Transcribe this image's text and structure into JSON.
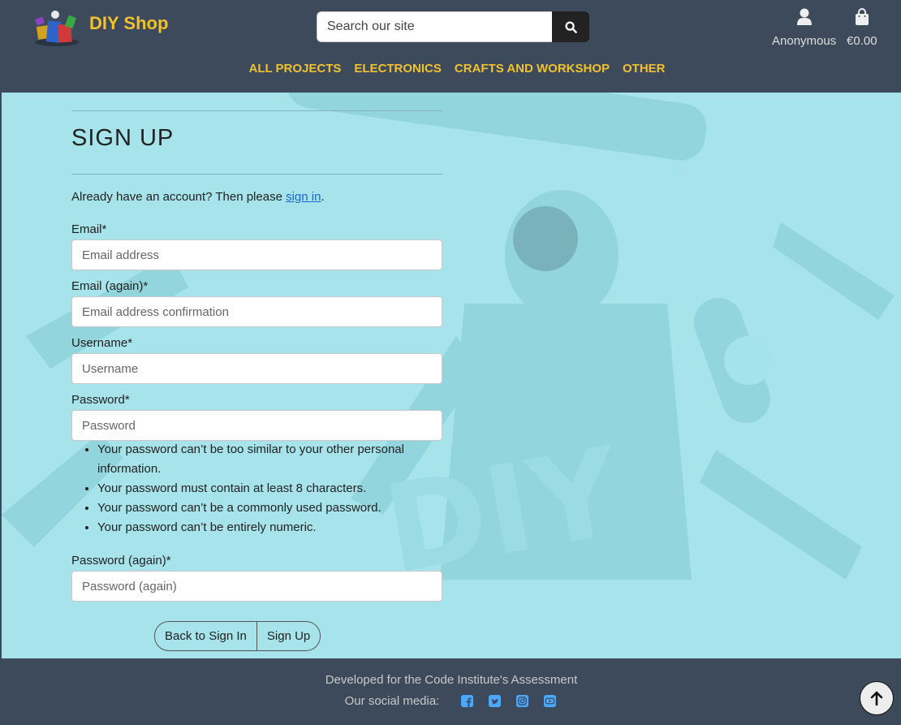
{
  "header": {
    "brand": "DIY Shop",
    "search_placeholder": "Search our site",
    "account_label": "Anonymous",
    "cart_total": "€0.00",
    "nav": [
      "ALL PROJECTS",
      "ELECTRONICS",
      "CRAFTS AND WORKSHOP",
      "OTHER"
    ]
  },
  "form": {
    "title": "SIGN UP",
    "signin_prefix": "Already have an account? Then please ",
    "signin_link": "sign in",
    "signin_suffix": ".",
    "email_label": "Email*",
    "email_placeholder": "Email address",
    "email2_label": "Email (again)*",
    "email2_placeholder": "Email address confirmation",
    "username_label": "Username*",
    "username_placeholder": "Username",
    "password_label": "Password*",
    "password_placeholder": "Password",
    "password_help": [
      "Your password can’t be too similar to your other personal information.",
      "Your password must contain at least 8 characters.",
      "Your password can’t be a commonly used password.",
      "Your password can’t be entirely numeric."
    ],
    "password2_label": "Password (again)*",
    "password2_placeholder": "Password (again)",
    "back_button": "Back to Sign In",
    "signup_button": "Sign Up"
  },
  "footer": {
    "line1": "Developed for the Code Institute's Assessment",
    "social_label": "Our social media:",
    "social_icons": [
      "facebook-icon",
      "twitter-icon",
      "instagram-icon",
      "youtube-icon"
    ]
  },
  "colors": {
    "header_bg": "#3c4a5b",
    "brand_yellow": "#f2c12e",
    "page_bg": "#a6e3ea",
    "link_blue": "#1a66d8"
  }
}
